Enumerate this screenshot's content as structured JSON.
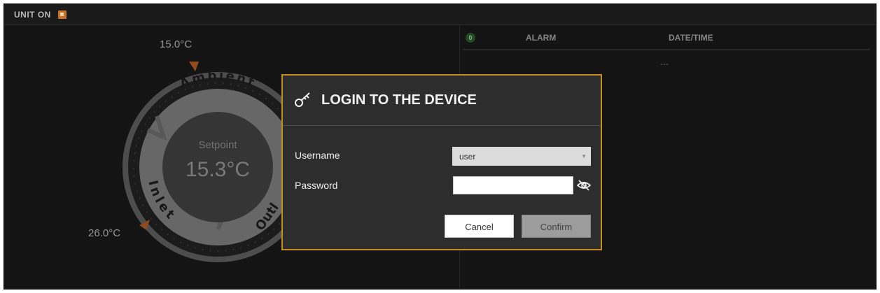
{
  "header": {
    "status": "UNIT ON",
    "status_icon": "unit-status-icon"
  },
  "gauge": {
    "setpoint_label": "Setpoint",
    "setpoint_value": "15.3°C",
    "top_temp": "15.0°C",
    "bottom_temp": "26.0°C",
    "sections": [
      "Ambient",
      "Inlet",
      "Outl"
    ]
  },
  "alarms": {
    "count": "0",
    "col_alarm": "ALARM",
    "col_datetime": "DATE/TIME",
    "empty_placeholder": "---"
  },
  "login_dialog": {
    "title": "LOGIN TO THE DEVICE",
    "username_label": "Username",
    "username_value": "user",
    "password_label": "Password",
    "password_value": "",
    "cancel_label": "Cancel",
    "confirm_label": "Confirm"
  },
  "colors": {
    "accent": "#c98a1e",
    "marker": "#c8682a",
    "background": "#1e1e1e"
  }
}
